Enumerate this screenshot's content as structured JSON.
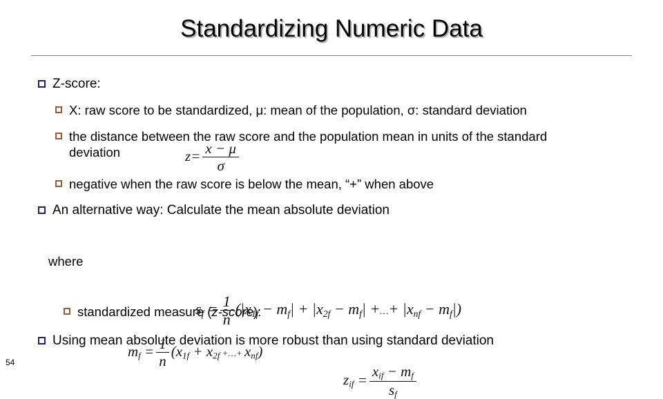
{
  "slide": {
    "title": "Standardizing Numeric Data",
    "page_number": "54",
    "accent_colors": {
      "level1_bullet": "#1f1f6e",
      "level2_bullet": "#9c5a36",
      "rule": "#808080",
      "text": "#000000"
    }
  },
  "bullets": {
    "b1": "Z-score:",
    "b2": "X: raw score to be standardized, μ: mean of the population, σ: standard deviation",
    "b3": "the distance between the raw score and the population mean in units of the standard deviation",
    "b4": "negative when the raw score is below the mean, “+” when above",
    "b5": "An alternative way: Calculate the mean absolute deviation",
    "where": "where",
    "b6_prefix": "standardized measure (",
    "b6_italic": "z-score",
    "b6_suffix": "):",
    "b7": "Using mean absolute deviation is more robust than using standard deviation"
  },
  "equations": {
    "zscore": {
      "lhs": "z",
      "eq": "=",
      "numerator": "x − μ",
      "denominator": "σ",
      "plain": "z = (x − μ) / σ"
    },
    "mean_abs_dev": {
      "lhs": "s",
      "lhs_sub": "f",
      "eq": "=",
      "num": "1",
      "den": "n",
      "body": "(|x1f − mf| + |x2f − mf| + … + |xnf − mf|)",
      "plain": "s_f = 1/n ( |x_1f − m_f| + |x_2f − m_f| + … + |x_nf − m_f| )"
    },
    "mean_f": {
      "lhs": "m",
      "lhs_sub": "f",
      "eq": "=",
      "num": "1",
      "den": "n",
      "body": "(x1f + x2f + … + xnf)",
      "plain": "m_f = 1/n ( x_1f + x_2f + … + x_nf )"
    },
    "zscore_mad": {
      "lhs": "z",
      "lhs_sub": "if",
      "eq": "=",
      "numerator": "xif − mf",
      "denominator": "sf",
      "plain": "z_if = (x_if − m_f) / s_f"
    }
  }
}
